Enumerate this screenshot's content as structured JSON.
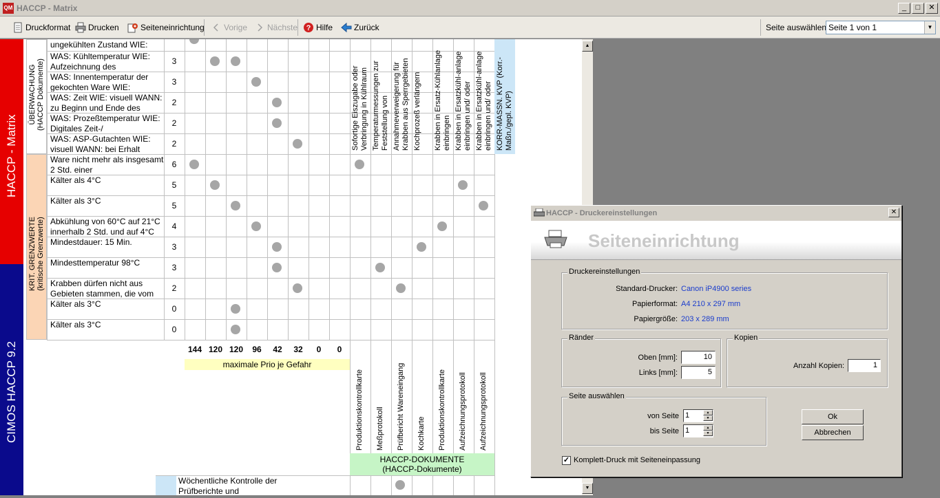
{
  "window": {
    "icon_text": "QM",
    "title": "HACCP - Matrix",
    "min": "_",
    "max": "□",
    "close": "✕"
  },
  "toolbar": {
    "print_format": "Druckformat",
    "print": "Drucken",
    "page_setup": "Seiteneinrichtung",
    "prev": "Vorige",
    "next": "Nächste",
    "help": "Hilfe",
    "back": "Zurück",
    "page_select_label": "Seite auswählen",
    "page_select_value": "Seite 1 von 1"
  },
  "sidebar": {
    "top": "HACCP - Matrix",
    "bottom": "CIMOS HACCP 9.2"
  },
  "categories": {
    "monitoring": "ÜBERWACHUNG\n(HACCP Dokumente)",
    "limits": "KRIT. GRENZWERTE\n(kritische Grenzwerte)"
  },
  "rows": [
    {
      "text": "ungekühlten Zustand WIE:",
      "prio": "3"
    },
    {
      "text": "WAS: Kühltemperatur WIE: Aufzeichnung des",
      "prio": "3"
    },
    {
      "text": "WAS: Innentemperatur der gekochten Ware WIE:",
      "prio": "3"
    },
    {
      "text": "WAS: Zeit WIE: visuell WANN: zu Beginn und  Ende des",
      "prio": "2"
    },
    {
      "text": "WAS: Prozeßtemperatur WIE: Digitales Zeit-/",
      "prio": "2"
    },
    {
      "text": "WAS: ASP-Gutachten WIE: visuell WANN: bei Erhalt",
      "prio": "2"
    },
    {
      "text": "Ware nicht mehr als insgesamt 2 Std. einer",
      "prio": "6"
    },
    {
      "text": "Kälter als 4°C",
      "prio": "5"
    },
    {
      "text": "Kälter als 3°C",
      "prio": "5"
    },
    {
      "text": "Abkühlung von 60°C auf 21°C innerhalb 2 Std. und auf 4°C",
      "prio": "4"
    },
    {
      "text": "Mindestdauer: 15 Min.",
      "prio": "3"
    },
    {
      "text": "Mindesttemperatur 98°C",
      "prio": "3"
    },
    {
      "text": "Krabben dürfen nicht aus Gebieten stammen, die vom",
      "prio": "2"
    },
    {
      "text": "Kälter als 3°C",
      "prio": "0"
    },
    {
      "text": "Kälter als 3°C",
      "prio": "0"
    }
  ],
  "measures": [
    "Sofortige Eiszugabe oder Verbringung in Kühlraum",
    "Temperaturmessungen zur Feststellung von",
    "Annahmeverweigerung für Krabben aus Sperrgebieten",
    "Kochprozeß verlängern",
    "Krabben in Ersatz-Kühlanlage einbringen",
    "Krabben in Ersatzkühl-anlage einbringen und/ oder",
    "Krabben in Ersatzkühl-anlage einbringen und/ oder",
    "KORR-MASSN. KVP (Korr.-Maßn./gepl. KVP)"
  ],
  "scores": [
    "144",
    "120",
    "120",
    "96",
    "42",
    "32",
    "0",
    "0"
  ],
  "scores_label": "maximale Prio je Gefahr",
  "documents": [
    "Produktionskontrollkarte",
    "Meßprotokoll",
    "Prüfbericht Wareneingang",
    "Kochkarte",
    "Produktionskontrollkarte",
    "Aufzeichnungsprotokoll",
    "Aufzeichnungsprotokoll"
  ],
  "documents_label": "HACCP-DOKUMENTE\n(HACCP-Dokumente)",
  "bottom_row": "Wöchentliche Kontrolle der Prüfberichte und",
  "dialog": {
    "title": "HACCP - Druckereinstellungen",
    "close": "✕",
    "heading": "Seiteneinrichtung",
    "printer_group": "Druckereinstellungen",
    "std_printer_label": "Standard-Drucker:",
    "std_printer_value": "Canon iP4900 series",
    "paper_format_label": "Papierformat:",
    "paper_format_value": "A4 210 x 297 mm",
    "paper_size_label": "Papiergröße:",
    "paper_size_value": "203 x 289 mm",
    "margins_group": "Ränder",
    "top_label": "Oben [mm]:",
    "top_value": "10",
    "left_label": "Links [mm]:",
    "left_value": "5",
    "copies_group": "Kopien",
    "copies_label": "Anzahl Kopien:",
    "copies_value": "1",
    "pages_group": "Seite auswählen",
    "from_label": "von Seite",
    "from_value": "1",
    "to_label": "bis Seite",
    "to_value": "1",
    "ok": "Ok",
    "cancel": "Abbrechen",
    "fit_check": "✓",
    "fit_label": "Komplett-Druck mit Seiteneinpassung"
  },
  "colors": {
    "sidebar_red": "#e60000",
    "sidebar_blue": "#0a0a8c",
    "category_limits": "#fbd5b5",
    "dot": "#a6a6a6",
    "link_blue": "#1a3ccc"
  }
}
